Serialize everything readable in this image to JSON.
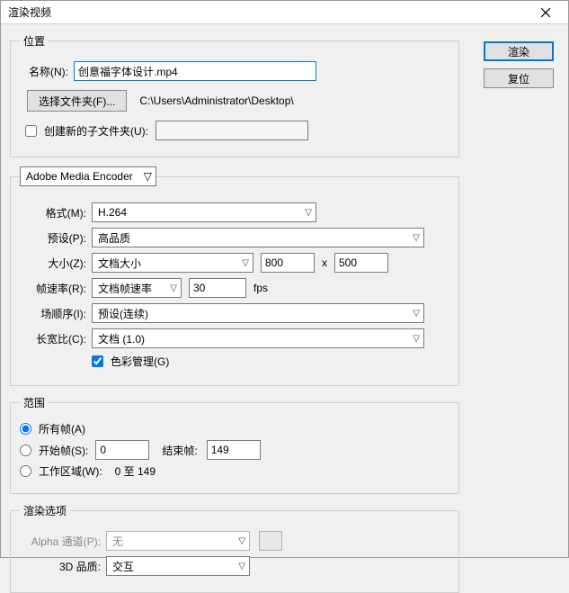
{
  "window": {
    "title": "渲染视频"
  },
  "buttons": {
    "render": "渲染",
    "reset": "复位"
  },
  "location": {
    "legend": "位置",
    "name_label": "名称(N):",
    "name_value": "创意福字体设计.mp4",
    "choose_folder_btn": "选择文件夹(F)...",
    "folder_path": "C:\\Users\\Administrator\\Desktop\\",
    "create_subfolder_label": "创建新的子文件夹(U):",
    "create_subfolder_value": ""
  },
  "encoder": {
    "legend_value": "Adobe Media Encoder",
    "format_label": "格式(M):",
    "format_value": "H.264",
    "preset_label": "预设(P):",
    "preset_value": "高品质",
    "size_label": "大小(Z):",
    "size_mode": "文档大小",
    "size_w": "800",
    "size_x": "x",
    "size_h": "500",
    "fps_label": "帧速率(R):",
    "fps_mode": "文档帧速率",
    "fps_value": "30",
    "fps_unit": "fps",
    "order_label": "场顺序(I):",
    "order_value": "预设(连续)",
    "aspect_label": "长宽比(C):",
    "aspect_value": "文档 (1.0)",
    "color_mgmt_label": "色彩管理(G)"
  },
  "range": {
    "legend": "范围",
    "all_label": "所有帧(A)",
    "start_label": "开始帧(S):",
    "start_value": "0",
    "end_label": "结束帧:",
    "end_value": "149",
    "work_label": "工作区域(W):",
    "work_text": "0 至 149"
  },
  "options": {
    "legend": "渲染选项",
    "alpha_label": "Alpha 通道(P):",
    "alpha_value": "无",
    "quality_label": "3D 品质:",
    "quality_value": "交互"
  }
}
